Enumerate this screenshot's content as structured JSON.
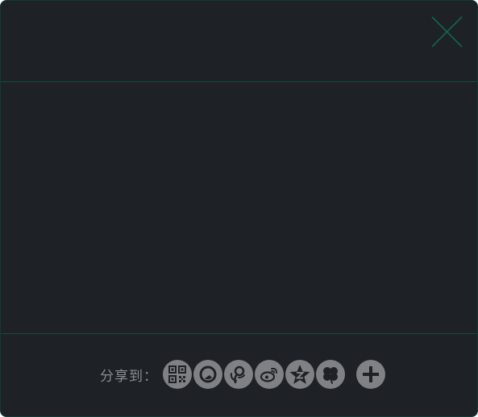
{
  "dialog": {
    "close_icon": "close-icon",
    "accent_color": "#0f5a4c",
    "background_color": "#1e2226"
  },
  "share": {
    "label": "分享到：",
    "targets": [
      {
        "name": "qrcode",
        "icon": "qrcode-icon"
      },
      {
        "name": "qzone",
        "icon": "qzone-icon"
      },
      {
        "name": "tencent-weibo",
        "icon": "tencent-weibo-icon"
      },
      {
        "name": "sina-weibo",
        "icon": "sina-weibo-icon"
      },
      {
        "name": "qq-star",
        "icon": "star-icon"
      },
      {
        "name": "renren",
        "icon": "clover-icon"
      }
    ],
    "more_icon": "plus-icon"
  }
}
